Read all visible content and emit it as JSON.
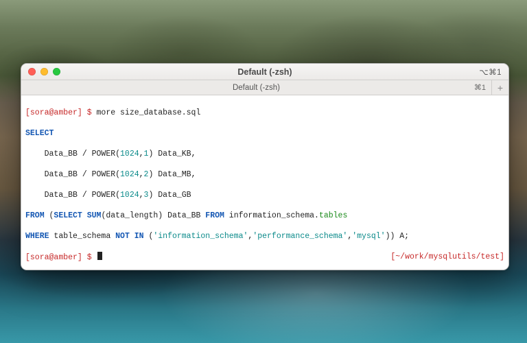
{
  "wallpaper": {
    "name": "big-sur-coastline"
  },
  "window": {
    "title": "Default (-zsh)",
    "shortcut": "⌥⌘1",
    "traffic": {
      "close": "close",
      "minimize": "minimize",
      "zoom": "zoom"
    }
  },
  "tabs": {
    "active": {
      "label": "Default (-zsh)",
      "shortcut": "⌘1"
    },
    "new_tab_glyph": "+"
  },
  "prompt": {
    "open": "[",
    "user_host": "sora@amber",
    "close_sym": "] $ "
  },
  "cmd1": "more size_database.sql",
  "sql": {
    "select": "SELECT",
    "l1a": "    Data_BB / POWER(",
    "n1024": "1024",
    "c1": ",",
    "p1": "1",
    "p2": "2",
    "p3": "3",
    "l1b": ") Data_KB,",
    "l2b": ") Data_MB,",
    "l3b": ") Data_GB",
    "from": "FROM",
    "lpar": " (",
    "selectkw": "SELECT",
    "sp": " ",
    "sum": "SUM",
    "sumarg": "(data_length) Data_BB ",
    "from2": "FROM",
    "ischema": " information_schema.",
    "tables": "tables",
    "where": "WHERE",
    "tschema": " table_schema ",
    "notin": "NOT IN",
    "args_open": " (",
    "s1": "'information_schema'",
    "comma": ",",
    "s2": "'performance_schema'",
    "s3": "'mysql'",
    "args_close": ")) A;"
  },
  "rprompt": "[~/work/mysqlutils/test]"
}
